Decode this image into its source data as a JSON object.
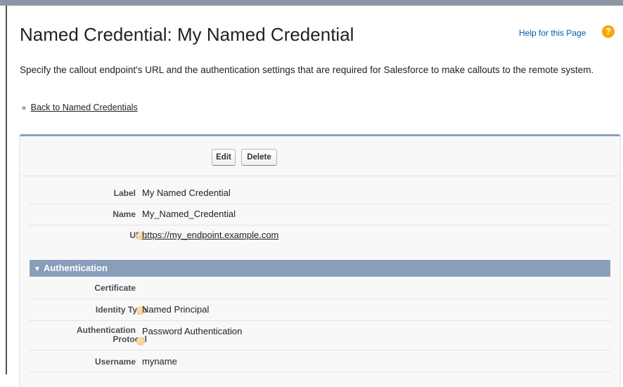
{
  "header": {
    "title": "Named Credential: My Named Credential",
    "help_link": "Help for this Page",
    "help_icon": "?"
  },
  "description": "Specify the callout endpoint's URL and the authentication settings that are required for Salesforce to make callouts to the remote system.",
  "back": {
    "prefix": "«",
    "label": "Back to Named Credentials"
  },
  "buttons": {
    "edit": "Edit",
    "delete": "Delete"
  },
  "details": {
    "label": {
      "label": "Label",
      "value": "My Named Credential"
    },
    "name": {
      "label": "Name",
      "value": "My_Named_Credential"
    },
    "url": {
      "label": "URL",
      "value": "https://my_endpoint.example.com"
    }
  },
  "authentication": {
    "section_title": "Authentication",
    "section_icon": "triangle-down",
    "certificate": {
      "label": "Certificate",
      "value": ""
    },
    "identity_type": {
      "label": "Identity Type",
      "value": "Named Principal"
    },
    "auth_protocol": {
      "label_line1": "Authentication",
      "label_line2": "Protocol",
      "value": "Password Authentication"
    },
    "username": {
      "label": "Username",
      "value": "myname"
    }
  },
  "colors": {
    "section_header": "#8a9ebb",
    "link_blue": "#015ba7",
    "help_icon": "#f3a711"
  }
}
